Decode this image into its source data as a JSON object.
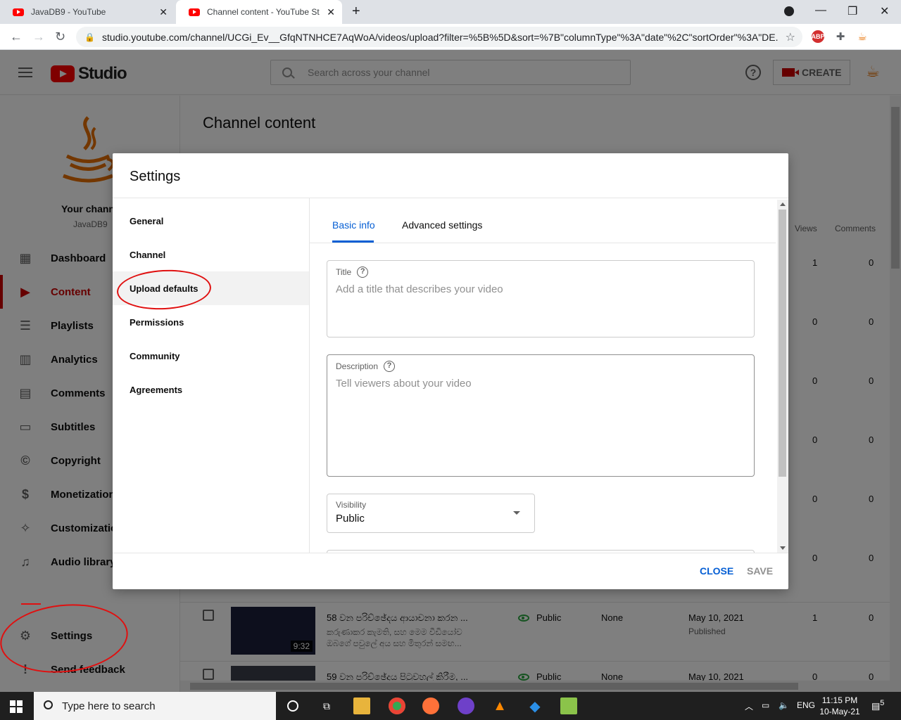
{
  "browser": {
    "tabs": [
      {
        "title": "JavaDB9 - YouTube"
      },
      {
        "title": "Channel content - YouTube Studio"
      }
    ],
    "url": "studio.youtube.com/channel/UCGi_Ev__GfqNTNHCE7AqWoA/videos/upload?filter=%5B%5D&sort=%7B\"columnType\"%3A\"date\"%2C\"sortOrder\"%3A\"DE..."
  },
  "header": {
    "logo_text": "Studio",
    "search_placeholder": "Search across your channel",
    "create_label": "CREATE"
  },
  "sidebar": {
    "channel_label": "Your channel",
    "channel_name": "JavaDB9",
    "items": [
      {
        "label": "Dashboard",
        "icon": "dashboard-icon"
      },
      {
        "label": "Content",
        "icon": "content-icon"
      },
      {
        "label": "Playlists",
        "icon": "playlists-icon"
      },
      {
        "label": "Analytics",
        "icon": "analytics-icon"
      },
      {
        "label": "Comments",
        "icon": "comments-icon"
      },
      {
        "label": "Subtitles",
        "icon": "subtitles-icon"
      },
      {
        "label": "Copyright",
        "icon": "copyright-icon"
      },
      {
        "label": "Monetization",
        "icon": "dollar-icon"
      },
      {
        "label": "Customization",
        "icon": "wand-icon"
      },
      {
        "label": "Audio library",
        "icon": "audio-library-icon"
      }
    ],
    "settings_label": "Settings",
    "feedback_label": "Send feedback"
  },
  "main": {
    "title": "Channel content",
    "columns": {
      "views": "Views",
      "comments": "Comments"
    },
    "row_counts": [
      {
        "views": "1",
        "comments": "0"
      },
      {
        "views": "0",
        "comments": "0"
      },
      {
        "views": "0",
        "comments": "0"
      },
      {
        "views": "0",
        "comments": "0"
      },
      {
        "views": "0",
        "comments": "0"
      },
      {
        "views": "0",
        "comments": "0"
      }
    ],
    "videos": [
      {
        "title": "58 වන පරිච්ඡේදය ආයාචනා කරන ...",
        "desc": "කරුණාකර කැමති, සහ මෙම වීඩියෝව ඔබගේ පවුලේ අය සහ මිතුරන් සමඟ...",
        "duration": "9:32",
        "visibility": "Public",
        "restrictions": "None",
        "date": "May 10, 2021",
        "status": "Published",
        "views": "1",
        "comments": "0"
      },
      {
        "title": "59 වන පරිච්ඡේදය පිටුවහල් කිරීම, ...",
        "visibility": "Public",
        "restrictions": "None",
        "date": "May 10, 2021",
        "views": "0",
        "comments": "0"
      }
    ]
  },
  "dialog": {
    "title": "Settings",
    "menu": [
      "General",
      "Channel",
      "Upload defaults",
      "Permissions",
      "Community",
      "Agreements"
    ],
    "selected_menu": "Upload defaults",
    "tabs": [
      "Basic info",
      "Advanced settings"
    ],
    "title_field": {
      "label": "Title",
      "placeholder": "Add a title that describes your video"
    },
    "description_field": {
      "label": "Description",
      "placeholder": "Tell viewers about your video"
    },
    "visibility_field": {
      "label": "Visibility",
      "value": "Public"
    },
    "close_label": "CLOSE",
    "save_label": "SAVE"
  },
  "taskbar": {
    "search_placeholder": "Type here to search",
    "language": "ENG",
    "time": "11:15 PM",
    "date": "10-May-21",
    "notifications": "5"
  },
  "colors": {
    "accent_blue": "#065fd4",
    "youtube_red": "#ff0000",
    "annotation_red": "#e01010"
  }
}
